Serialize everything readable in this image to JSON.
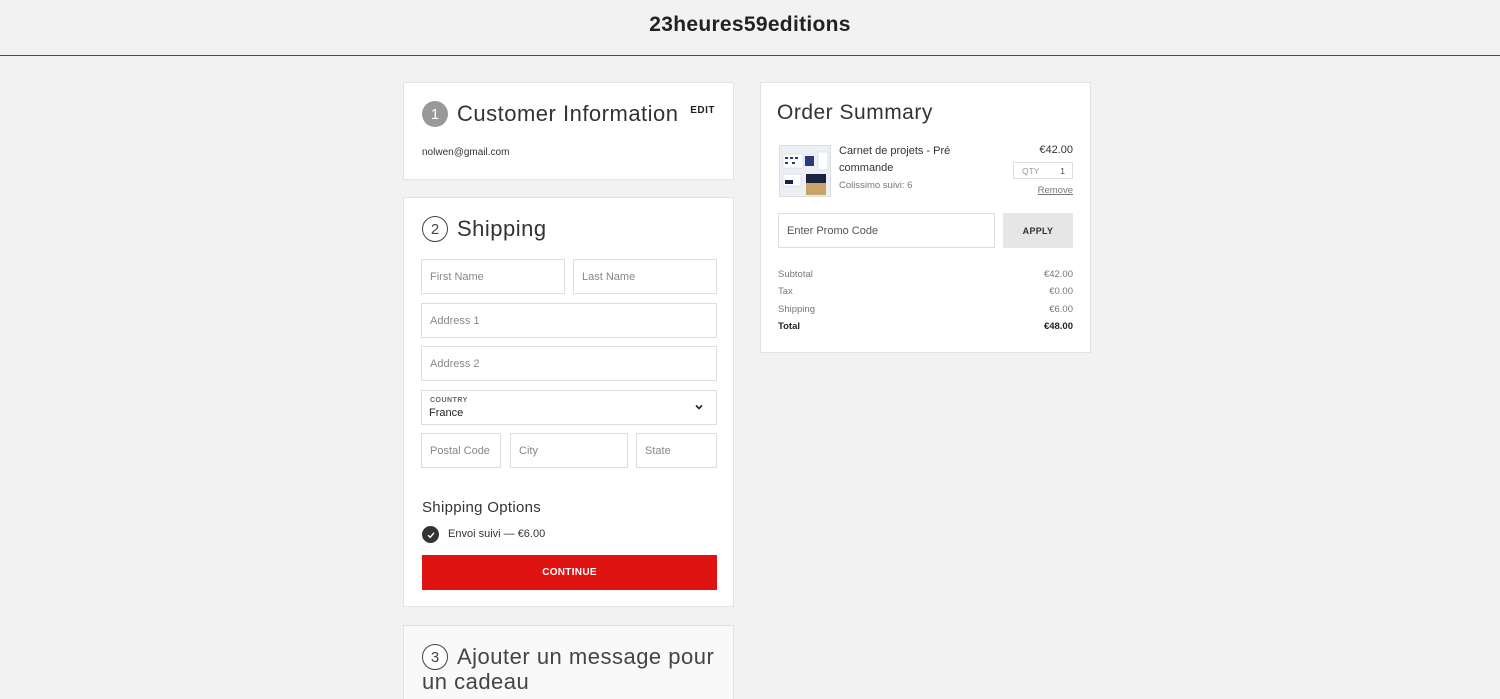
{
  "header": {
    "brand": "23heures59editions"
  },
  "customer": {
    "step": "1",
    "title": "Customer Information",
    "edit_label": "EDIT",
    "email": "nolwen@gmail.com"
  },
  "shipping": {
    "step": "2",
    "title": "Shipping",
    "first_name_placeholder": "First Name",
    "last_name_placeholder": "Last Name",
    "address1_placeholder": "Address 1",
    "address2_placeholder": "Address 2",
    "country_label": "COUNTRY",
    "country_value": "France",
    "postal_placeholder": "Postal Code",
    "city_placeholder": "City",
    "state_placeholder": "State",
    "options_title": "Shipping Options",
    "option_label": "Envoi suivi — €6.00",
    "continue_label": "CONTINUE"
  },
  "gift": {
    "step": "3",
    "title": "Ajouter un message pour un cadeau"
  },
  "summary": {
    "title": "Order Summary",
    "item": {
      "name": "Carnet de projets - Pré commande",
      "variant": "Colissimo suivi: 6",
      "price": "€42.00",
      "qty_label": "QTY",
      "qty": "1",
      "remove_label": "Remove"
    },
    "promo_placeholder": "Enter Promo Code",
    "apply_label": "APPLY",
    "rows": [
      {
        "label": "Subtotal",
        "value": "€42.00"
      },
      {
        "label": "Tax",
        "value": "€0.00"
      },
      {
        "label": "Shipping",
        "value": "€6.00"
      },
      {
        "label": "Total",
        "value": "€48.00"
      }
    ]
  },
  "colors": {
    "accent": "#e01313",
    "header_rule": "#9b2a2a"
  }
}
